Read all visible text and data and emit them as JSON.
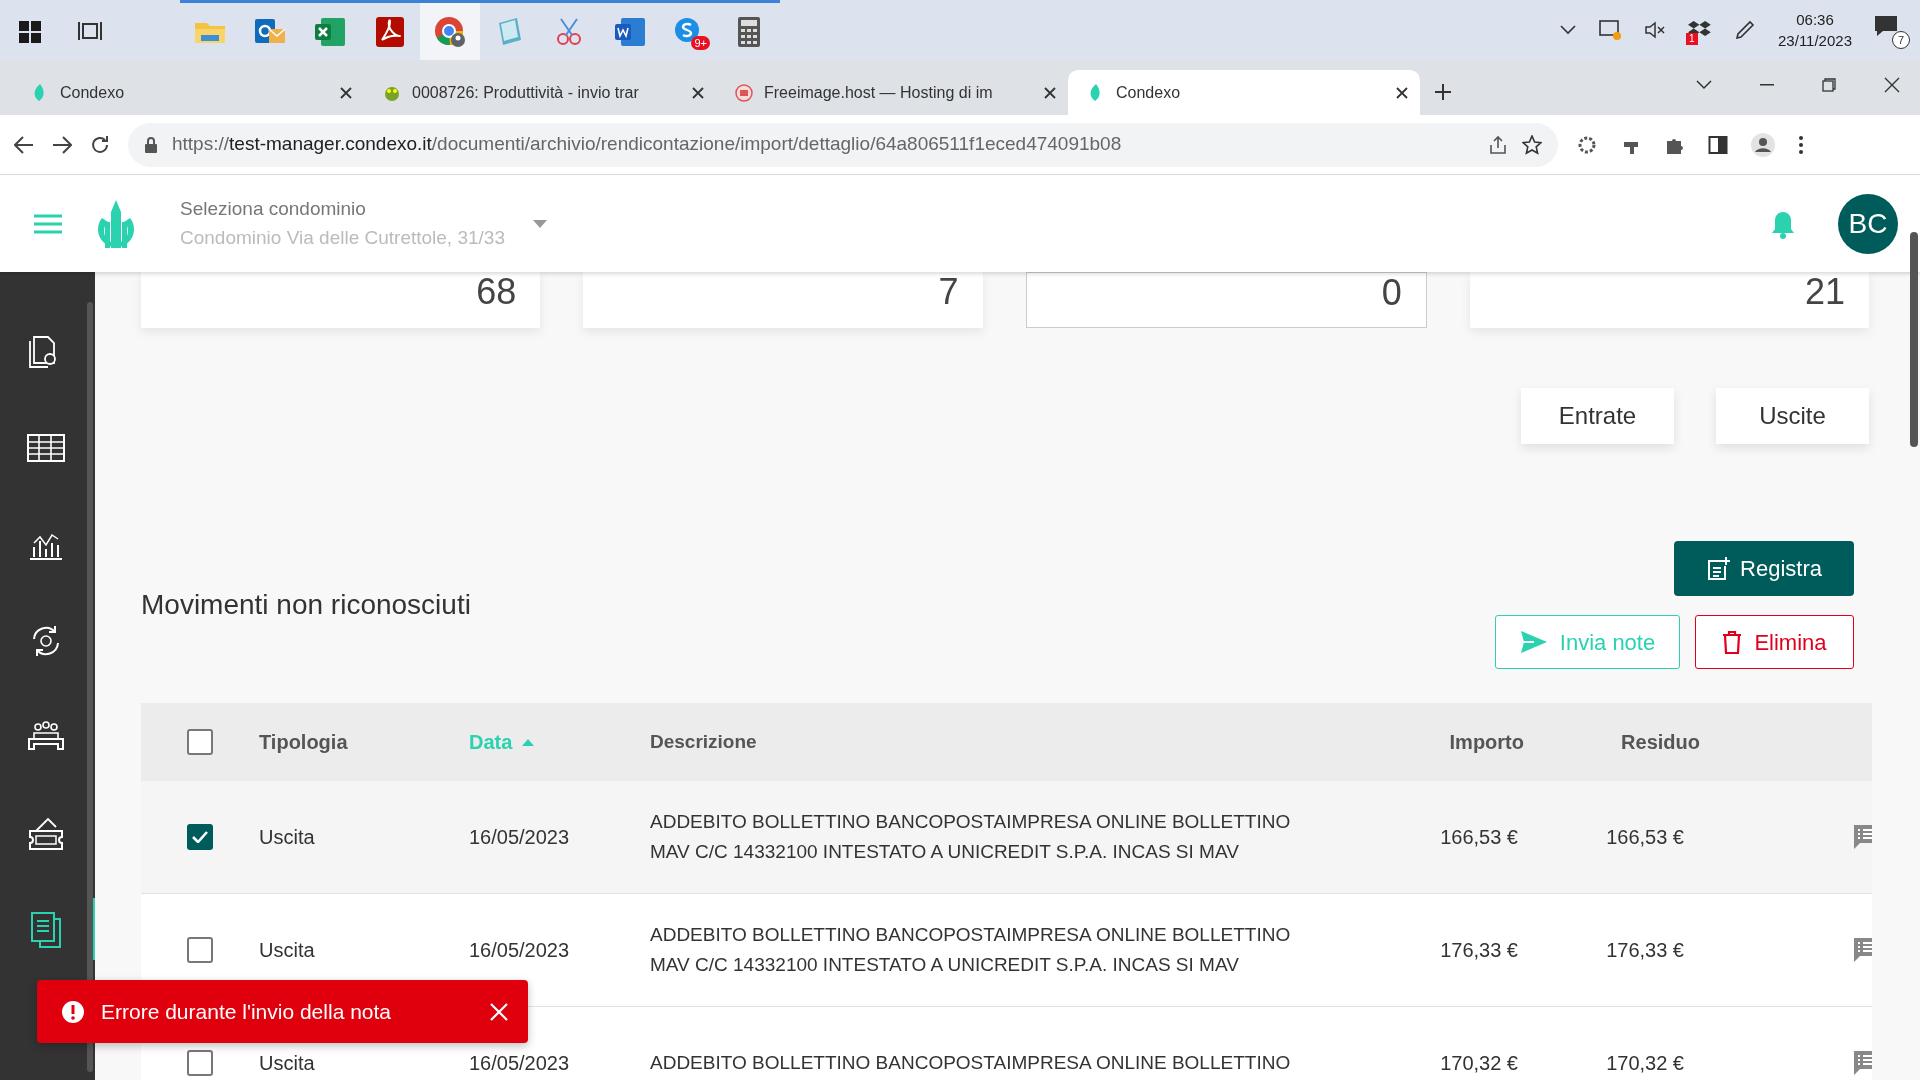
{
  "taskbar": {
    "apps": [
      {
        "kind": "folder",
        "selected": false
      },
      {
        "kind": "mail",
        "selected": false
      },
      {
        "kind": "sheet",
        "selected": false
      },
      {
        "kind": "pdf",
        "selected": false
      },
      {
        "kind": "browser",
        "selected": true
      },
      {
        "kind": "notebook",
        "selected": false
      },
      {
        "kind": "scissors",
        "selected": false
      },
      {
        "kind": "doc",
        "selected": false
      },
      {
        "kind": "chat",
        "selected": false,
        "badge": "9+"
      },
      {
        "kind": "calculator",
        "selected": false
      }
    ],
    "tray_badge": "1",
    "time": "06:36",
    "date": "23/11/2023",
    "notifications": "7"
  },
  "browser": {
    "tabs": [
      {
        "title": "Condexo",
        "kind": "condexo",
        "selected": false
      },
      {
        "title": "0008726: Produttività - invio trar",
        "kind": "tracker",
        "selected": false
      },
      {
        "title": "Freeimage.host — Hosting di im",
        "kind": "imagehost",
        "selected": false
      },
      {
        "title": "Condexo",
        "kind": "condexo",
        "selected": true
      }
    ],
    "url": {
      "scheme": "https://",
      "host": "test-manager.condexo.it",
      "path": "/documenti/archivio/rendicontazione/import/dettaglio/64a806511f1eced474091b08"
    }
  },
  "header": {
    "selector_label": "Seleziona condominio",
    "selector_value": "Condominio Via delle Cutrettole, 31/33",
    "avatar": "BC"
  },
  "sidebar": {
    "items": [
      {
        "kind": "doc-gear",
        "selected": false
      },
      {
        "kind": "table",
        "selected": false
      },
      {
        "kind": "chart",
        "selected": false
      },
      {
        "kind": "cycle",
        "selected": false
      },
      {
        "kind": "meeting",
        "selected": false
      },
      {
        "kind": "ticket",
        "selected": false
      },
      {
        "kind": "documents",
        "selected": true
      }
    ]
  },
  "stats": [
    {
      "value": "68",
      "selected": false
    },
    {
      "value": "7",
      "selected": false
    },
    {
      "value": "0",
      "selected": true
    },
    {
      "value": "21",
      "selected": false
    }
  ],
  "filters": [
    "Entrate",
    "Uscite"
  ],
  "register_button": "Registra",
  "section_title": "Movimenti non riconosciuti",
  "actions": [
    {
      "label": "Invia note",
      "kind": "send"
    },
    {
      "label": "Elimina",
      "kind": "delete"
    }
  ],
  "table": {
    "select_all": {
      "checked": false
    },
    "columns": [
      {
        "label": "Tipologia",
        "sorted": false
      },
      {
        "label": "Data",
        "sorted": true
      },
      {
        "label": "Descrizione",
        "sorted": false
      },
      {
        "label": "Importo",
        "sorted": false
      },
      {
        "label": "Residuo",
        "sorted": false
      }
    ],
    "rows": [
      {
        "checked": true,
        "tipologia": "Uscita",
        "data": "16/05/2023",
        "descrizione": "ADDEBITO BOLLETTINO BANCOPOSTAIMPRESA ONLINE BOLLETTINO MAV C/C 14332100 INTESTATO A UNICREDIT S.P.A. INCAS SI MAV",
        "importo": "166,53 €",
        "residuo": "166,53 €"
      },
      {
        "checked": false,
        "tipologia": "Uscita",
        "data": "16/05/2023",
        "descrizione": "ADDEBITO BOLLETTINO BANCOPOSTAIMPRESA ONLINE BOLLETTINO MAV C/C 14332100 INTESTATO A UNICREDIT S.P.A. INCAS SI MAV",
        "importo": "176,33 €",
        "residuo": "176,33 €"
      },
      {
        "checked": false,
        "tipologia": "Uscita",
        "data": "16/05/2023",
        "descrizione": "ADDEBITO BOLLETTINO BANCOPOSTAIMPRESA ONLINE BOLLETTINO",
        "importo": "170,32 €",
        "residuo": "170,32 €"
      }
    ]
  },
  "toast": {
    "message": "Errore durante l'invio della nota"
  }
}
